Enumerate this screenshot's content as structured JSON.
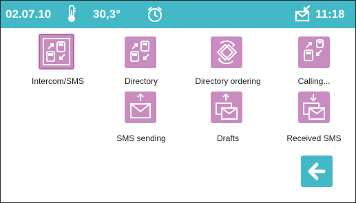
{
  "status_bar": {
    "date": "02.07.10",
    "temperature": "30,3°",
    "time": "11:18",
    "icons": [
      "thermometer-icon",
      "alarm-clock-icon",
      "message-in-icon"
    ]
  },
  "menu_items": [
    {
      "label": "Intercom/SMS",
      "icon": "intercom-icon",
      "selected": true
    },
    {
      "label": "Directory",
      "icon": "directory-icon",
      "selected": false
    },
    {
      "label": "Directory ordering",
      "icon": "ordering-icon",
      "selected": false
    },
    {
      "label": "Calling...",
      "icon": "calling-icon",
      "selected": false
    },
    {
      "label": "SMS sending",
      "icon": "sms-send-icon",
      "selected": false
    },
    {
      "label": "Drafts",
      "icon": "drafts-icon",
      "selected": false
    },
    {
      "label": "Received SMS",
      "icon": "sms-received-icon",
      "selected": false
    }
  ],
  "back_button": {
    "icon": "back-arrow-icon"
  },
  "colors": {
    "status_bar": "#43b9c8",
    "tile": "#c98cc0",
    "tile_selected_border": "#b269a6",
    "back_button": "#43b9c8"
  }
}
